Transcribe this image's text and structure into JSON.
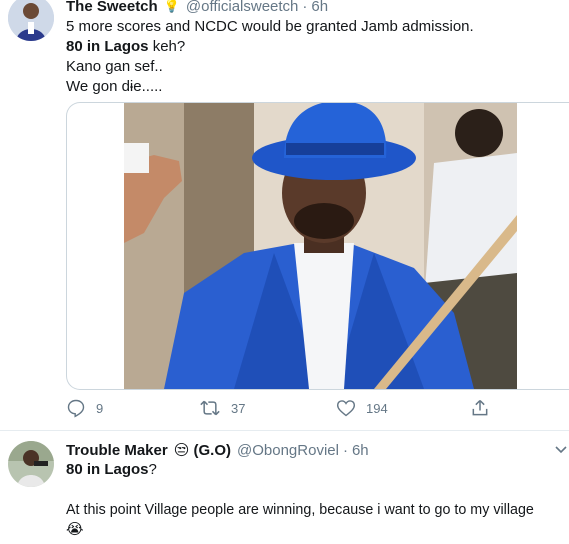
{
  "tweet1": {
    "display_name": "The Sweetch",
    "name_emoji": "💡",
    "handle": "@officialsweetch",
    "separator": "·",
    "time": "6h",
    "lines": [
      {
        "bold": "",
        "text": "5 more scores and NCDC would be granted Jamb admission."
      },
      {
        "bold": "80 in Lagos",
        "text": " keh?"
      },
      {
        "bold": "",
        "text": "Kano gan sef.."
      },
      {
        "bold": "",
        "text": "We gon dɨe....."
      }
    ],
    "actions": {
      "replies": "9",
      "retweets": "37",
      "likes": "194"
    }
  },
  "tweet2": {
    "display_name": "Trouble Maker",
    "name_emoji": "😒",
    "name_suffix": " (G.O)",
    "handle": "@ObongRoviel",
    "separator": "·",
    "time": "6h",
    "line1_bold": "80 in Lagos",
    "line1_rest": "?",
    "line2": "At this point Village people are winning, because i want to go to my village",
    "line3_emoji": "😭"
  },
  "colors": {
    "text": "#14171a",
    "secondary": "#657786",
    "border": "#ccd6dd",
    "hat_blue": "#1f56c9",
    "suit_blue": "#2a5fd0"
  }
}
